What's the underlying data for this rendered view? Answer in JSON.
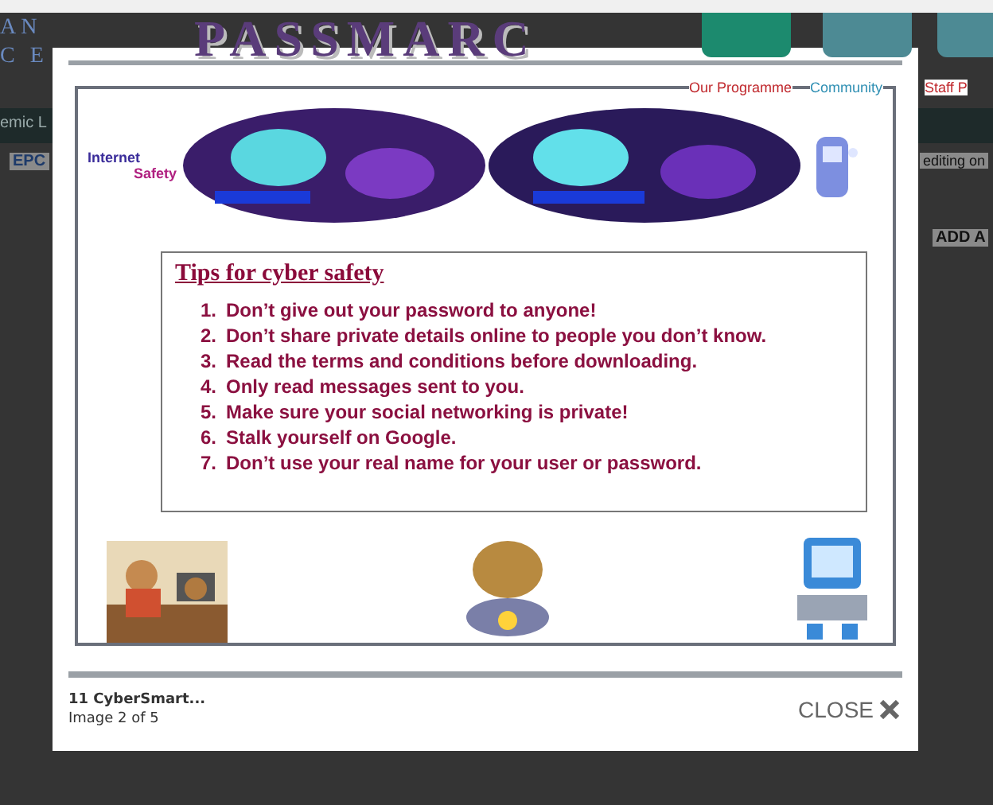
{
  "background_page": {
    "logo": "PASSMARC",
    "left_marks": [
      "AN",
      "C E"
    ],
    "nav": [
      {
        "label": "Our Programme",
        "color": "#c0282d"
      },
      {
        "label": "Community",
        "color": "#2f8fb3"
      },
      {
        "label": "Staff P",
        "color": "#c0282d"
      }
    ],
    "menu_text": "emic L",
    "tab_text": "EPC",
    "right_text": "editing on",
    "side_heading": "ADD A"
  },
  "lightbox": {
    "poster": {
      "badge": [
        "Internet",
        "Safety"
      ],
      "tips_title": "Tips for cyber safety",
      "tips": [
        {
          "number": "1.",
          "text": "Don’t give out your password to anyone!"
        },
        {
          "number": "2.",
          "text": "Don’t share private details online to people you don’t know."
        },
        {
          "number": "3.",
          "text": "Read the terms and conditions before downloading."
        },
        {
          "number": "4.",
          "text": "Only read messages sent to you."
        },
        {
          "number": "5.",
          "text": "Make sure your social networking is private!"
        },
        {
          "number": "6.",
          "text": "Stalk yourself on Google."
        },
        {
          "number": "7.",
          "text": "Don’t use your real name for your user or password."
        }
      ]
    },
    "caption": {
      "title": "11 CyberSmart...",
      "subtitle": "Image 2 of 5"
    },
    "close_label": "CLOSE"
  }
}
